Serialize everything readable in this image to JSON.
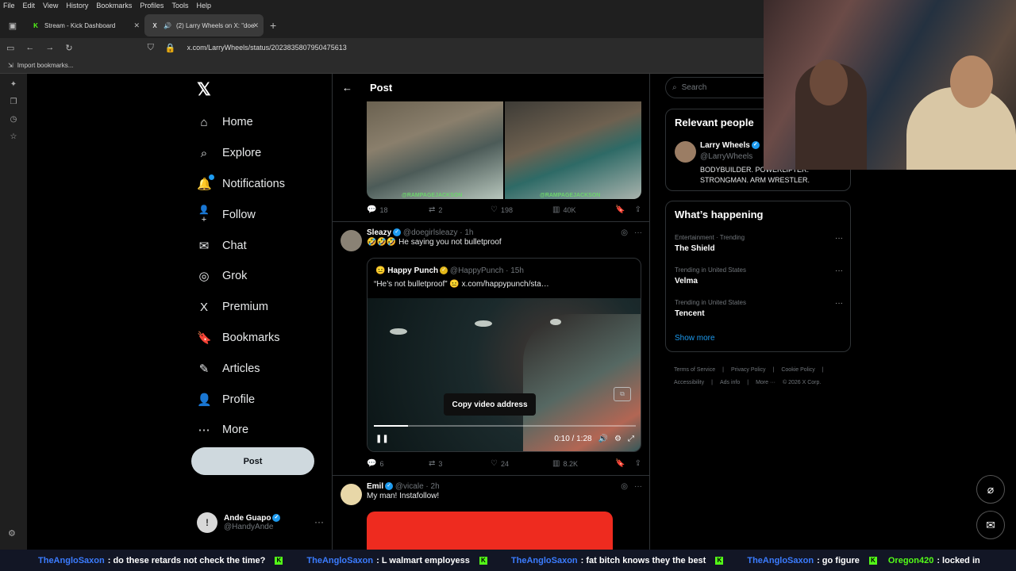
{
  "browser": {
    "menu": [
      "File",
      "Edit",
      "View",
      "History",
      "Bookmarks",
      "Profiles",
      "Tools",
      "Help"
    ],
    "tabs": [
      {
        "title": "Stream - Kick Dashboard"
      },
      {
        "title": "(2) Larry Wheels on X: \"doe"
      }
    ],
    "url": "x.com/LarryWheels/status/2023835807950475613",
    "bookmarks_label": "Import bookmarks..."
  },
  "nav": {
    "items": [
      {
        "label": "Home",
        "icon": "⌂"
      },
      {
        "label": "Explore",
        "icon": "⌕"
      },
      {
        "label": "Notifications",
        "icon": "🔔"
      },
      {
        "label": "Follow",
        "icon": "👤+"
      },
      {
        "label": "Chat",
        "icon": "✉"
      },
      {
        "label": "Grok",
        "icon": "◎"
      },
      {
        "label": "Premium",
        "icon": "X"
      },
      {
        "label": "Bookmarks",
        "icon": "🔖"
      },
      {
        "label": "Articles",
        "icon": "✎"
      },
      {
        "label": "Profile",
        "icon": "👤"
      },
      {
        "label": "More",
        "icon": "⋯"
      }
    ],
    "post_button": "Post",
    "account": {
      "name": "Ande Guapo",
      "handle": "@HandyAnde",
      "avatar_letter": "!"
    }
  },
  "header": {
    "title": "Post"
  },
  "first_post": {
    "watermark": "@RAMPAGEJACKSON",
    "stats": {
      "replies": "18",
      "reposts": "2",
      "likes": "198",
      "views": "40K"
    }
  },
  "tweet_sleazy": {
    "name": "Sleazy",
    "handle": "@doegirlsleazy",
    "time": "· 1h",
    "text": "🤣🤣🤣 He saying you not bulletproof",
    "quote": {
      "name": "Happy Punch",
      "handle": "@HappyPunch",
      "time": "· 15h",
      "text": "“He’s not bulletproof” 😐 x.com/happypunch/sta…",
      "video": {
        "tooltip": "Copy video address",
        "time": "0:10 / 1:28",
        "progress": 0.13
      }
    },
    "stats": {
      "replies": "6",
      "reposts": "3",
      "likes": "24",
      "views": "8.2K"
    }
  },
  "tweet_emil": {
    "name": "Emil",
    "handle": "@vicale",
    "time": "· 2h",
    "text": "My man! Instafollow!"
  },
  "right": {
    "search_placeholder": "Search",
    "relevant": {
      "title": "Relevant people",
      "name": "Larry Wheels",
      "handle": "@LarryWheels",
      "bio": "BODYBUILDER. POWERLIFTER. STRONGMAN. ARM WRESTLER."
    },
    "happening": {
      "title": "What’s happening",
      "trends": [
        {
          "context": "Entertainment · Trending",
          "name": "The Shield"
        },
        {
          "context": "Trending in United States",
          "name": "Velma"
        },
        {
          "context": "Trending in United States",
          "name": "Tencent"
        }
      ],
      "show_more": "Show more"
    },
    "footer": [
      "Terms of Service",
      "|",
      "Privacy Policy",
      "|",
      "Cookie Policy",
      "|",
      "Accessibility",
      "|",
      "Ads info",
      "|",
      "More ···",
      "© 2026 X Corp."
    ]
  },
  "ticker": [
    {
      "user": "TheAngloSaxon",
      "msg": ": do these retards not check the time?"
    },
    {
      "user": "TheAngloSaxon",
      "msg": ": L walmart employess"
    },
    {
      "user": "TheAngloSaxon",
      "msg": ": fat bitch knows they the best"
    },
    {
      "user": "TheAngloSaxon",
      "msg": ": go figure"
    },
    {
      "user": "Oregon420",
      "msg": ": locked in"
    }
  ]
}
